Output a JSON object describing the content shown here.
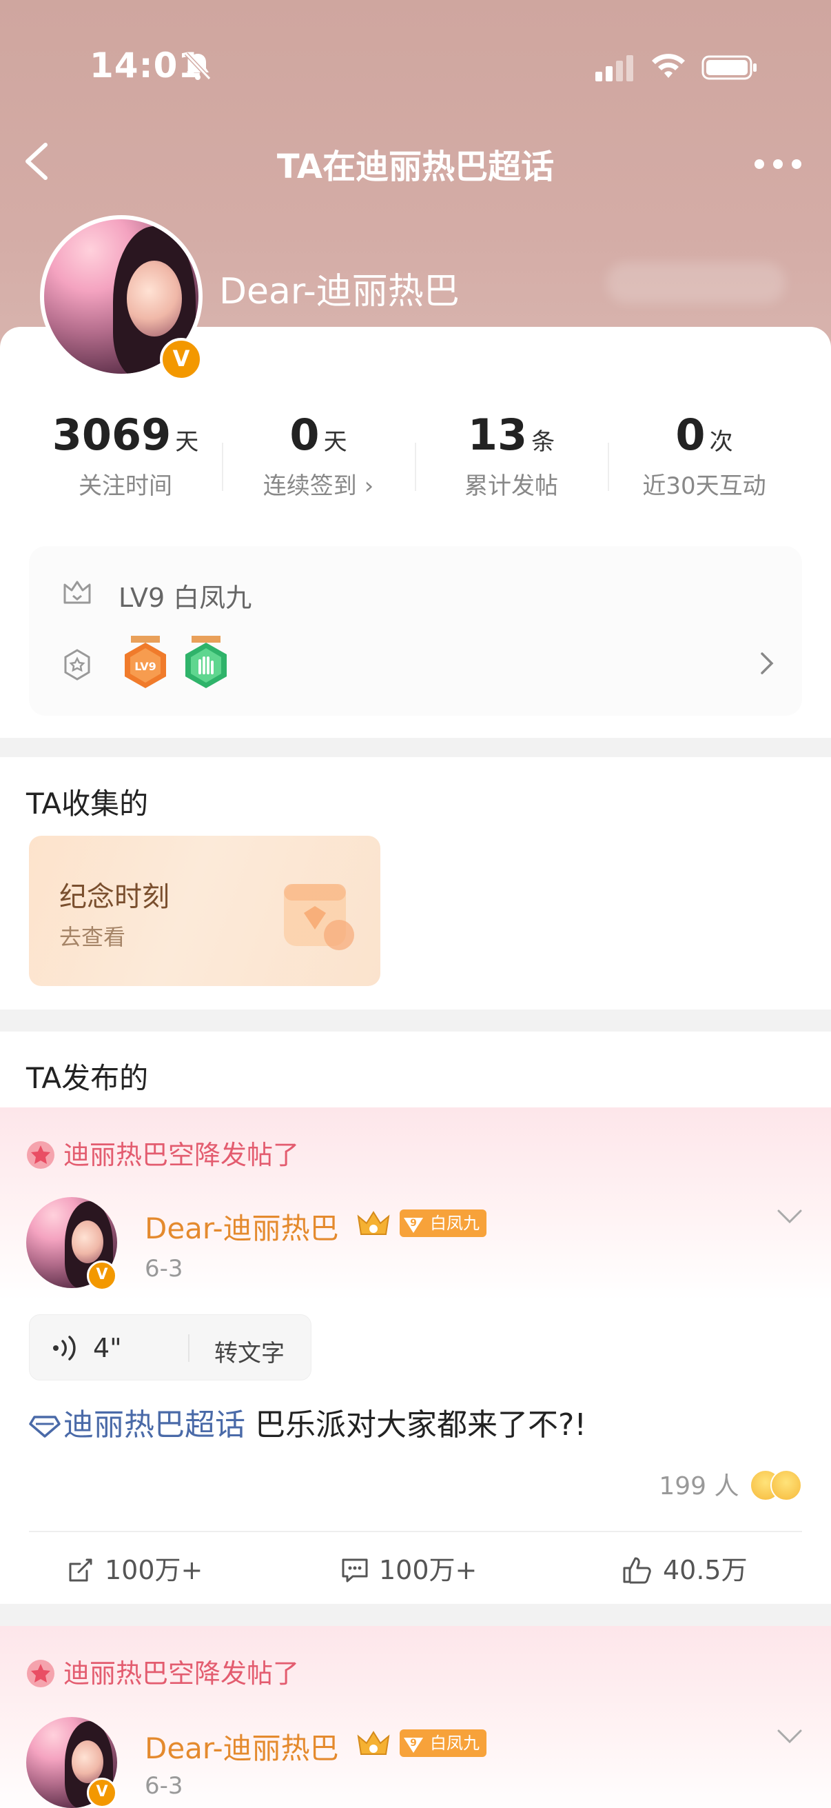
{
  "status_bar": {
    "time": "14:01"
  },
  "nav": {
    "title": "TA在迪丽热巴超话"
  },
  "profile": {
    "name": "Dear-迪丽热巴",
    "verified_badge": "V"
  },
  "stats": [
    {
      "value": "3069",
      "unit": "天",
      "label": "关注时间"
    },
    {
      "value": "0",
      "unit": "天",
      "label": "连续签到 ›"
    },
    {
      "value": "13",
      "unit": "条",
      "label": "累计发帖"
    },
    {
      "value": "0",
      "unit": "次",
      "label": "近30天互动"
    }
  ],
  "level": {
    "text": "LV9  白凤九",
    "badge1_label": "LV9"
  },
  "collected": {
    "title": "TA收集的",
    "card_title": "纪念时刻",
    "card_sub": "去查看"
  },
  "posted": {
    "title": "TA发布的"
  },
  "posts": [
    {
      "airdrop": "迪丽热巴空降发帖了",
      "author": "Dear-迪丽热巴",
      "level_num": "9",
      "level_tag": "白凤九",
      "date": "6-3",
      "voice_duration": "4\"",
      "voice_convert": "转文字",
      "topic": "迪丽热巴超话",
      "text": " 巴乐派对大家都来了不?!",
      "reactions": "199 人",
      "share": "100万+",
      "comment": "100万+",
      "like": "40.5万"
    },
    {
      "airdrop": "迪丽热巴空降发帖了",
      "author": "Dear-迪丽热巴",
      "level_num": "9",
      "level_tag": "白凤九",
      "date": "6-3"
    }
  ],
  "colors": {
    "header_bg": "#cfa69f",
    "accent_orange": "#e48a2e",
    "airdrop_red": "#e35c6f",
    "topic_blue": "#4a6aa8",
    "verified": "#f39800"
  }
}
